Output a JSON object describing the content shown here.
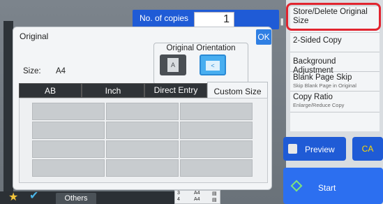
{
  "header": {
    "copies_label": "No. of copies",
    "copies_value": "1"
  },
  "dialog": {
    "title": "Original",
    "ok_label": "OK",
    "orientation": {
      "title": "Original Orientation",
      "option_a_glyph": "A",
      "option_b_glyph": "<"
    },
    "size_label": "Size:",
    "size_value": "A4",
    "tabs": [
      {
        "label": "AB",
        "active": false
      },
      {
        "label": "Inch",
        "active": false
      },
      {
        "label": "Direct Entry",
        "active": false
      },
      {
        "label": "Custom Size",
        "active": true
      }
    ],
    "custom_grid": {
      "rows": 4,
      "cols": 3
    }
  },
  "right_menu": {
    "items": [
      {
        "title": "Store/Delete Original Size",
        "subtitle": ""
      },
      {
        "title": "2-Sided Copy",
        "subtitle": ""
      },
      {
        "title": "Background Adjustment",
        "subtitle": ""
      },
      {
        "title": "Blank Page Skip",
        "subtitle": "Skip Blank Page in Original"
      },
      {
        "title": "Copy Ratio",
        "subtitle": "Enlarge/Reduce Copy"
      }
    ]
  },
  "actions": {
    "preview_label": "Preview",
    "ca_label": "CA",
    "start_label": "Start"
  },
  "bottom": {
    "others_label": "Others",
    "trays": [
      {
        "num": "3",
        "size": "A4"
      },
      {
        "num": "4",
        "size": "A4"
      }
    ]
  },
  "colors": {
    "accent_blue": "#1f5bd6",
    "highlight_red": "#e1242f",
    "start_green": "#7fe37c",
    "ca_yellow": "#ffd800"
  },
  "icons": [
    "star-icon",
    "check-icon",
    "preview-icon",
    "start-icon",
    "scroll-indicator-icon"
  ]
}
